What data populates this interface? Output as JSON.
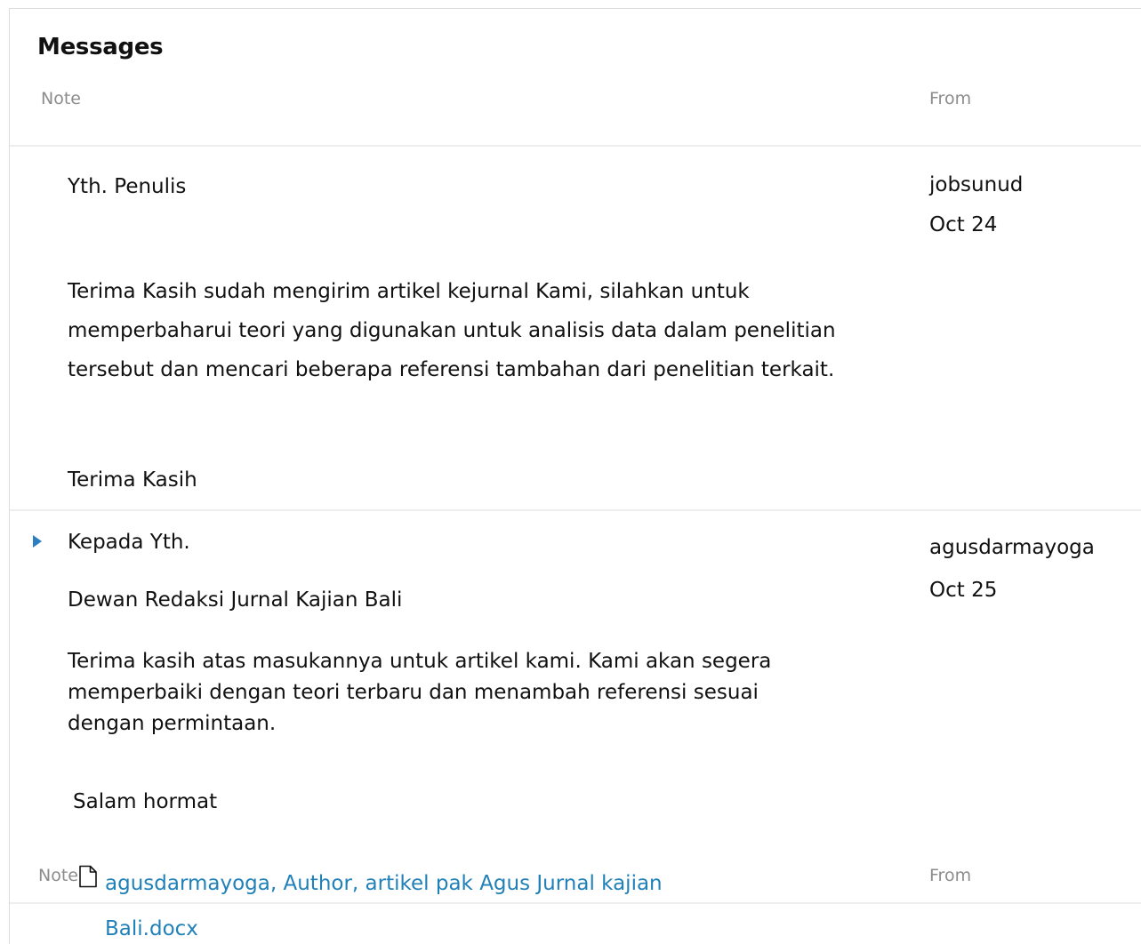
{
  "page": {
    "title": "Messages"
  },
  "table": {
    "col_note": "Note",
    "col_from": "From"
  },
  "messages": [
    {
      "paragraphs": [
        "Yth. Penulis",
        "Terima Kasih sudah mengirim artikel kejurnal Kami, silahkan untuk memperbaharui teori yang digunakan untuk analisis data dalam penelitian tersebut dan mencari beberapa referensi tambahan dari penelitian terkait.",
        "Terima Kasih"
      ],
      "author": "jobsunud",
      "date": "Oct 24"
    },
    {
      "paragraphs": [
        "Kepada Yth.",
        "Dewan Redaksi Jurnal Kajian Bali",
        "Terima kasih atas masukannya untuk artikel kami. Kami akan segera memperbaiki dengan teori terbaru dan menambah referensi sesuai dengan permintaan.",
        "Salam hormat"
      ],
      "author": "agusdarmayoga",
      "date": "Oct 25",
      "attachment": "agusdarmayoga, Author, artikel pak Agus Jurnal kajian Bali.docx"
    }
  ],
  "footer": {
    "col_note": "Note",
    "col_from": "From"
  },
  "icons": {
    "expand": "caret-right-icon",
    "file": "file-icon"
  },
  "colors": {
    "link": "#2080b8",
    "caret": "#2d7ec0",
    "muted": "#8c8c8c"
  }
}
